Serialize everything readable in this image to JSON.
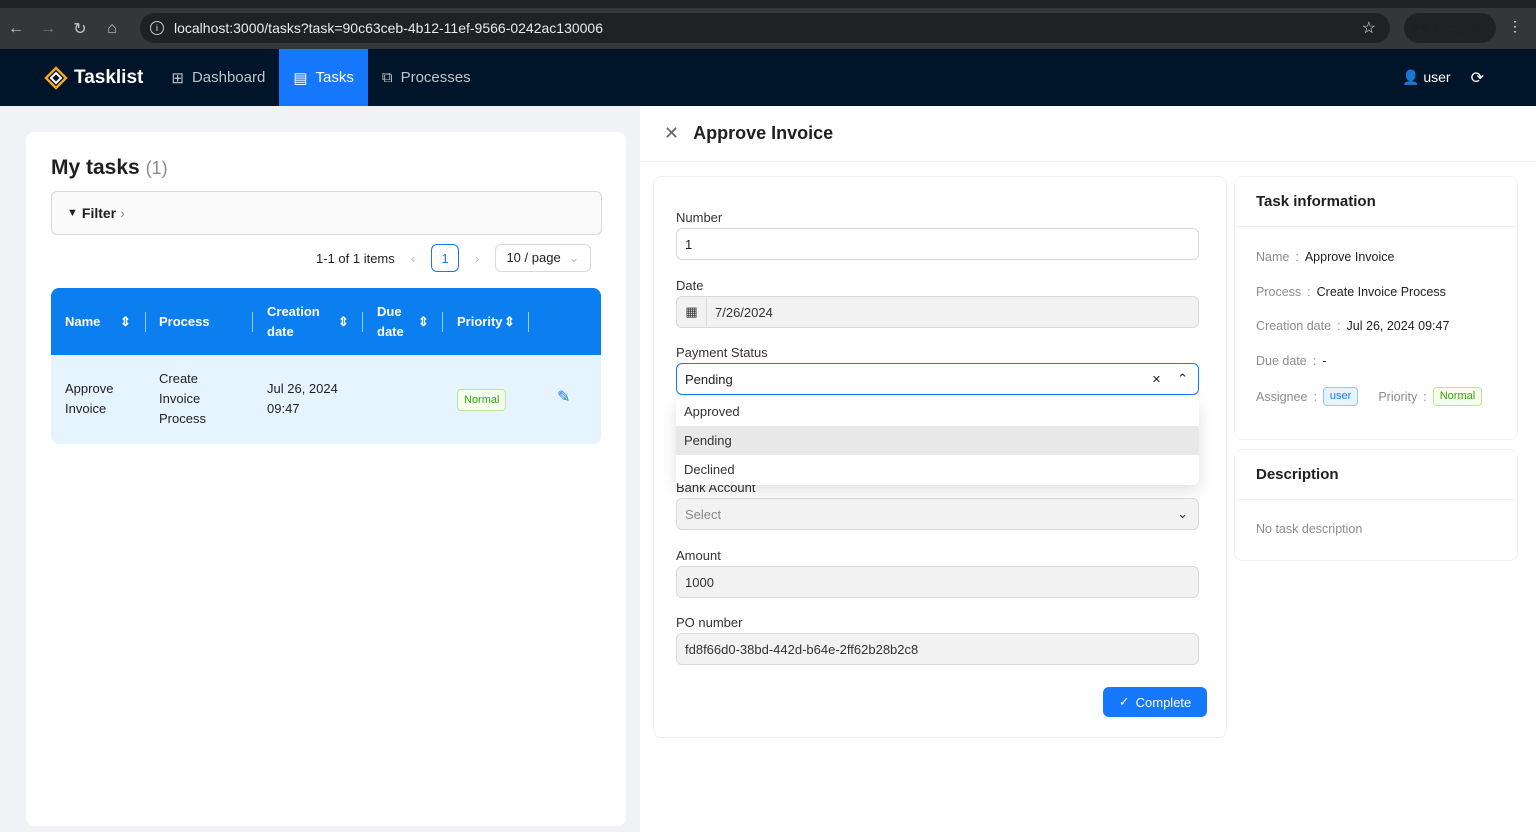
{
  "browser": {
    "url": "localhost:3000/tasks?task=90c63ceb-4b12-11ef-9566-0242ac130006",
    "incognito": "Incognito"
  },
  "nav": {
    "brand": "Tasklist",
    "items": [
      {
        "label": "Dashboard"
      },
      {
        "label": "Tasks"
      },
      {
        "label": "Processes"
      }
    ],
    "user": "user",
    "accent": "#1677ff"
  },
  "list": {
    "title": "My tasks",
    "count": "(1)",
    "filter": "Filter",
    "range": "1-1 of 1 items",
    "page": "1",
    "page_size": "10 / page",
    "columns": [
      "Name",
      "Process",
      "Creation date",
      "Due date",
      "Priority"
    ],
    "rows": [
      {
        "name": "Approve Invoice",
        "process": "Create Invoice Process",
        "created": "Jul 26, 2024 09:47",
        "due": "",
        "priority": "Normal"
      }
    ]
  },
  "detail": {
    "title": "Approve Invoice",
    "fields": {
      "number_label": "Number",
      "number": "1",
      "date_label": "Date",
      "date": "7/26/2024",
      "status_label": "Payment Status",
      "status": "Pending",
      "status_options": [
        "Approved",
        "Pending",
        "Declined"
      ],
      "bank_label": "Bank Account",
      "bank_placeholder": "Select",
      "amount_label": "Amount",
      "amount": "1000",
      "po_label": "PO number",
      "po": "fd8f66d0-38bd-442d-b64e-2ff62b28b2c8"
    },
    "complete": "Complete"
  },
  "info": {
    "title": "Task information",
    "name_k": "Name",
    "name": "Approve Invoice",
    "process_k": "Process",
    "process": "Create Invoice Process",
    "created_k": "Creation date",
    "created": "Jul 26, 2024 09:47",
    "due_k": "Due date",
    "due": "-",
    "assignee_k": "Assignee",
    "assignee": "user",
    "priority_k": "Priority",
    "priority": "Normal"
  },
  "description": {
    "title": "Description",
    "text": "No task description"
  }
}
